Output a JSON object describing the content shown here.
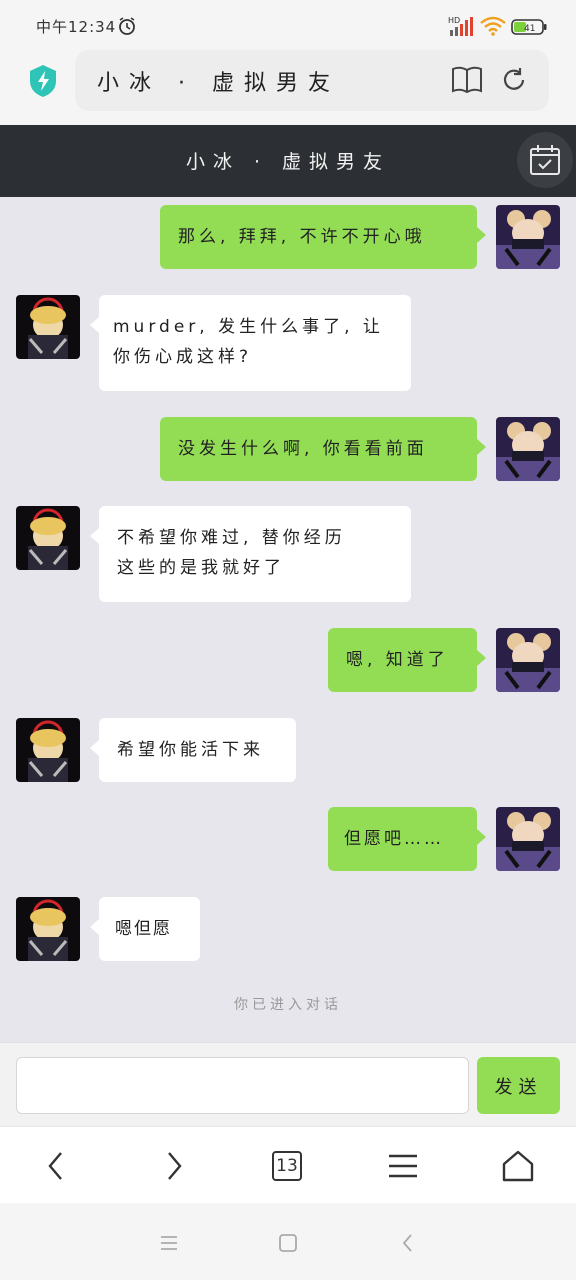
{
  "status_bar": {
    "time": "中午12:34",
    "icons": [
      "alarm-icon",
      "signal-icon",
      "wifi-icon",
      "battery-icon"
    ],
    "signal_label": "HD",
    "battery_level": "41"
  },
  "browser": {
    "address": "小冰 · 虚拟男友",
    "shield_color": "#2ec4b6",
    "tab_count": "13"
  },
  "chat": {
    "title": "小冰 · 虚拟男友",
    "messages": [
      {
        "sender": "me",
        "text": "那么, 拜拜, 不许不开心哦"
      },
      {
        "sender": "other",
        "text_lines": [
          "murder, 发生什么事了, 让",
          "你伤心成这样?"
        ]
      },
      {
        "sender": "me",
        "text": "没发生什么啊, 你看看前面"
      },
      {
        "sender": "other",
        "text_lines": [
          "不希望你难过, 替你经历",
          "这些的是我就好了"
        ]
      },
      {
        "sender": "me",
        "text": "嗯, 知道了"
      },
      {
        "sender": "other",
        "text": "希望你能活下来"
      },
      {
        "sender": "me",
        "text": "但愿吧……"
      },
      {
        "sender": "other",
        "text": "嗯但愿"
      }
    ],
    "system_note": "你已进入对话"
  },
  "input": {
    "value": "",
    "placeholder": "",
    "send_label": "发送"
  },
  "colors": {
    "accent_green": "#93dd55",
    "header_dark": "#2c2f33",
    "chat_bg": "#e7e6ec"
  }
}
